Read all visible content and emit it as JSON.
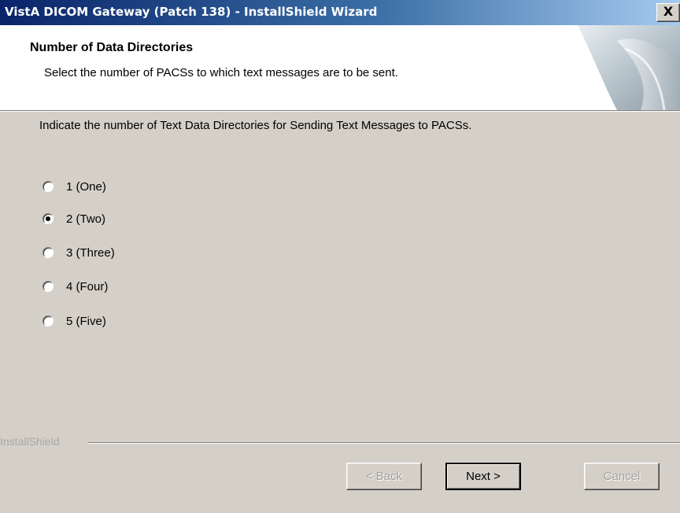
{
  "window": {
    "title": "VistA DICOM Gateway (Patch 138) - InstallShield Wizard",
    "close_label": "X"
  },
  "header": {
    "title": "Number of Data Directories",
    "subtitle": "Select the number of PACSs to which text messages are to be sent."
  },
  "main": {
    "instruction": "Indicate the number of Text Data Directories for Sending Text Messages to PACSs.",
    "options": [
      {
        "label": "1 (One)",
        "checked": false
      },
      {
        "label": "2 (Two)",
        "checked": true
      },
      {
        "label": "3 (Three)",
        "checked": false
      },
      {
        "label": "4 (Four)",
        "checked": false
      },
      {
        "label": "5 (Five)",
        "checked": false
      }
    ]
  },
  "footer": {
    "brand": "InstallShield",
    "back_label": "< Back",
    "next_label": "Next >",
    "cancel_label": "Cancel"
  }
}
